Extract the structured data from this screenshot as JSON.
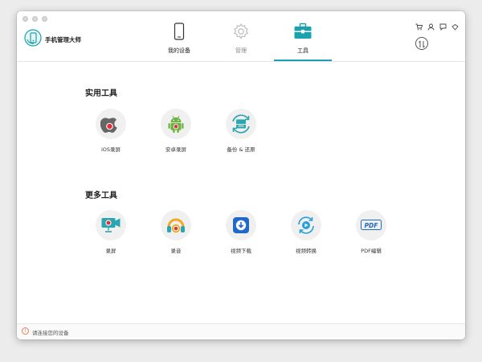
{
  "app": {
    "title": "手机管理大师"
  },
  "tabs": [
    {
      "label": "我的设备",
      "icon": "phone-icon",
      "state": "normal"
    },
    {
      "label": "管理",
      "icon": "gear-icon",
      "state": "muted"
    },
    {
      "label": "工具",
      "icon": "toolbox-icon",
      "state": "active"
    }
  ],
  "top_icons": [
    "cart-icon",
    "user-icon",
    "feedback-icon",
    "gift-icon"
  ],
  "sections": {
    "practical": {
      "title": "实用工具",
      "tools": [
        {
          "label": "iOS录屏",
          "icon": "apple-record-icon"
        },
        {
          "label": "安卓录屏",
          "icon": "android-record-icon"
        },
        {
          "label": "备份 & 还原",
          "icon": "backup-restore-icon"
        }
      ]
    },
    "more": {
      "title": "更多工具",
      "tools": [
        {
          "label": "录屏",
          "icon": "screen-record-icon"
        },
        {
          "label": "录音",
          "icon": "audio-record-icon"
        },
        {
          "label": "视频下载",
          "icon": "video-download-icon"
        },
        {
          "label": "视频转换",
          "icon": "video-convert-icon"
        },
        {
          "label": "PDF编辑",
          "icon": "pdf-edit-icon"
        }
      ]
    }
  },
  "pdf_icon_text": "PDF",
  "footer": {
    "status": "请连接您的设备"
  },
  "colors": {
    "accent": "#1ba3ad",
    "warning": "#f07c52",
    "record_red": "#e2303c"
  }
}
